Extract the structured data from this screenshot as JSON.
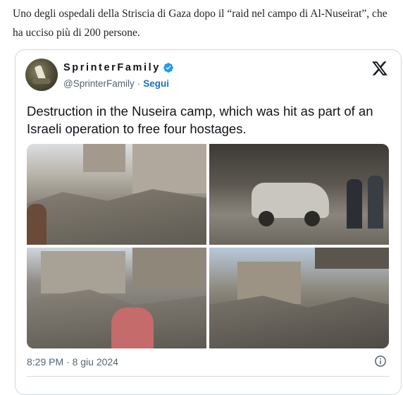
{
  "caption": "Uno degli ospedali della Striscia di Gaza dopo il “raid nel campo di Al-Nuseirat”, che ha ucciso più di 200 persone.",
  "tweet": {
    "display_name": "SprinterFamily",
    "handle": "@SprinterFamily",
    "separator": "·",
    "follow_label": "Segui",
    "text": "Destruction in the Nuseira camp, which was hit as part of an Israeli operation to free four hostages.",
    "timestamp": "8:29 PM · 8 giu 2024"
  },
  "icons": {
    "brand": "x-logo-icon",
    "verified": "verified-badge-icon",
    "info": "info-icon"
  },
  "colors": {
    "link": "#1d6fc6",
    "verified": "#1d9bf0",
    "muted": "#536471",
    "text": "#0f1419",
    "border": "#cfd9de"
  }
}
